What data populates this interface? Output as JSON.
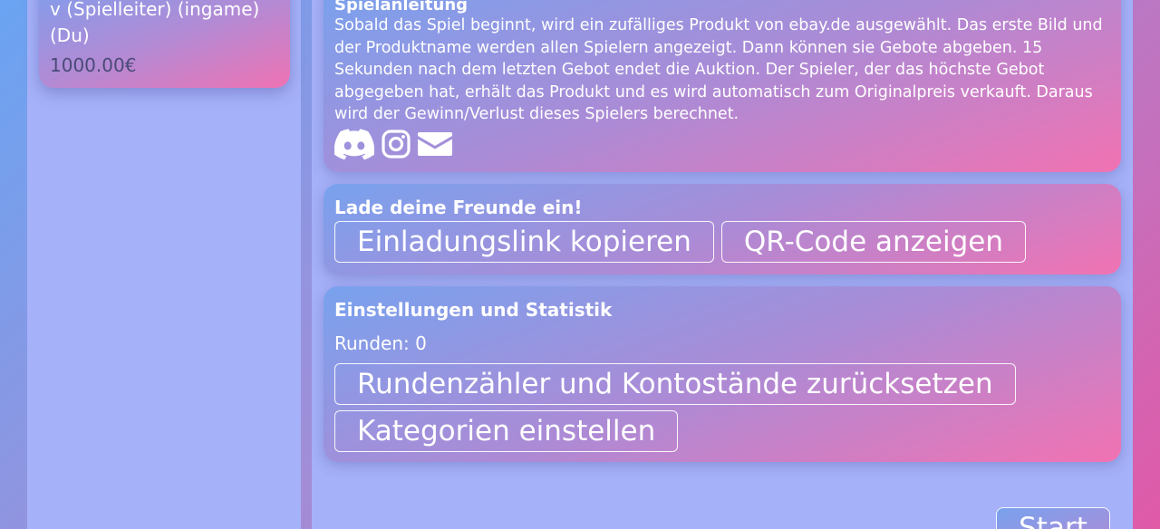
{
  "players": [
    {
      "name": "v (Spielleiter) (ingame) (Du)",
      "balance": "1000.00€"
    }
  ],
  "instructions": {
    "title": "Spielanleitung",
    "text": "Sobald das Spiel beginnt, wird ein zufälliges Produkt von ebay.de ausgewählt. Das erste Bild und der Produktname werden allen Spielern angezeigt. Dann können sie Gebote abgeben. 15 Sekunden nach dem letzten Gebot endet die Auktion. Der Spieler, der das höchste Gebot abgegeben hat, erhält das Produkt und es wird automatisch zum Originalpreis verkauft. Daraus wird der Gewinn/Verlust dieses Spielers berechnet.",
    "social_icons": [
      "discord-icon",
      "instagram-icon",
      "envelope-icon"
    ]
  },
  "invite": {
    "title": "Lade deine Freunde ein!",
    "copy_link_label": "Einladungslink kopieren",
    "qr_label": "QR-Code anzeigen"
  },
  "settings": {
    "title": "Einstellungen und Statistik",
    "rounds_label": "Runden: 0",
    "reset_label": "Rundenzähler und Kontostände zurücksetzen",
    "categories_label": "Kategorien einstellen"
  },
  "start_label": "Start",
  "colors": {
    "panel": "#a5b1f8",
    "card_start": "#78a2ee",
    "card_end": "#f172b2",
    "balance_text": "#4a4a78"
  }
}
